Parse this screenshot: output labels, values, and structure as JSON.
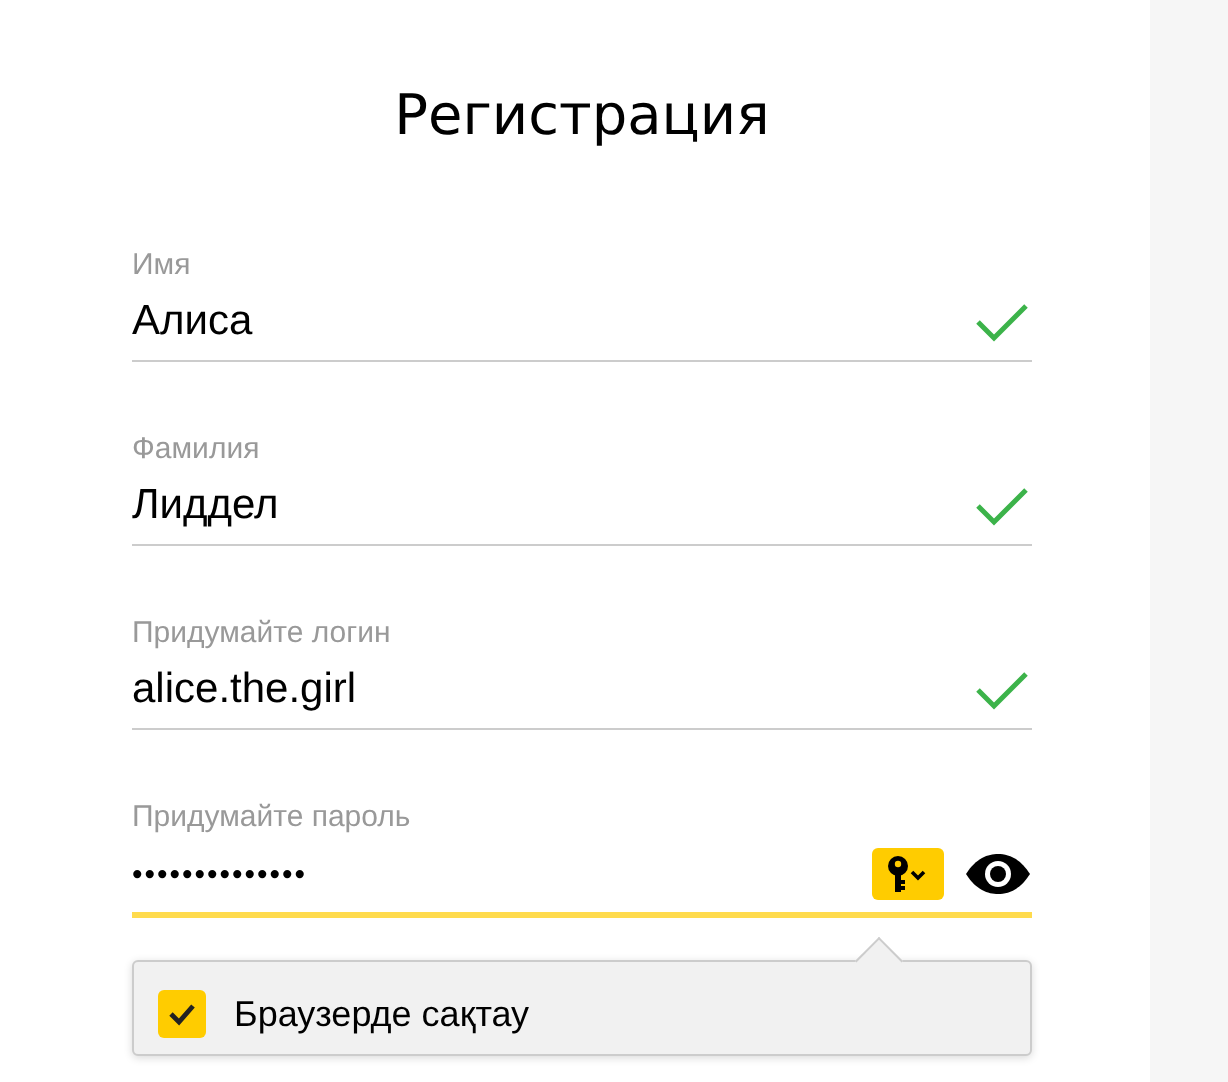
{
  "title": "Регистрация",
  "fields": [
    {
      "kind": "text",
      "label": "Имя",
      "value": "Алиса",
      "valid": true,
      "focused": false
    },
    {
      "kind": "text",
      "label": "Фамилия",
      "value": "Лиддел",
      "valid": true,
      "focused": false
    },
    {
      "kind": "text",
      "label": "Придумайте логин",
      "value": "alice.the.girl",
      "valid": true,
      "focused": false
    },
    {
      "kind": "password",
      "label": "Придумайте пароль",
      "value": "••••••••••••••",
      "valid": false,
      "focused": true
    }
  ],
  "save_popup": {
    "label": "Браузерде сақтау",
    "checked": true
  }
}
